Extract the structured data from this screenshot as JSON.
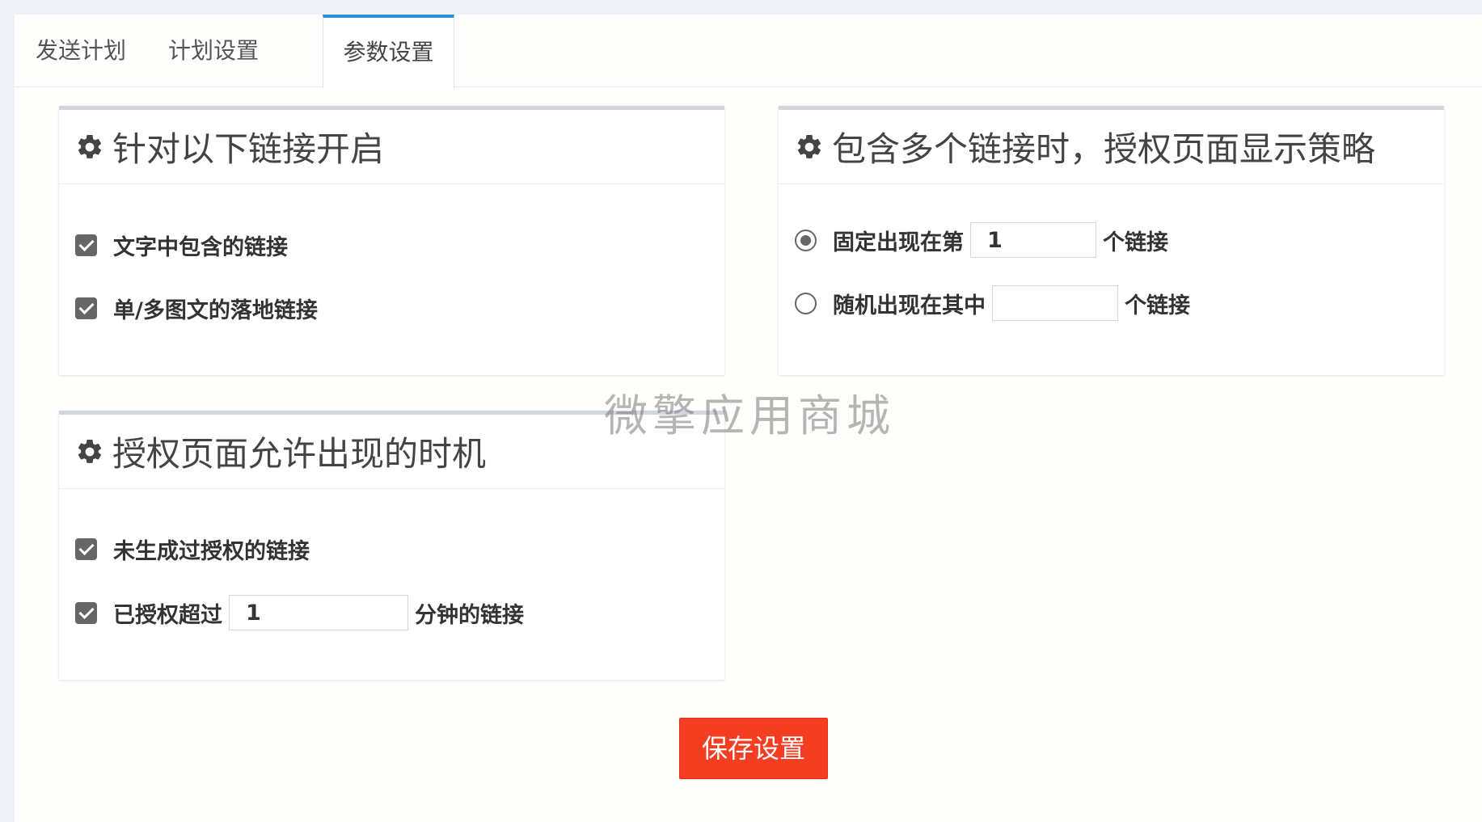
{
  "tabs": [
    {
      "label": "发送计划",
      "active": false
    },
    {
      "label": "计划设置",
      "active": false
    },
    {
      "label": "参数设置",
      "active": true
    }
  ],
  "panel_links": {
    "title": "针对以下链接开启",
    "icon": "gear-icon",
    "options": [
      {
        "label": "文字中包含的链接",
        "checked": true
      },
      {
        "label": "单/多图文的落地链接",
        "checked": true
      }
    ]
  },
  "panel_strategy": {
    "title": "包含多个链接时，授权页面显示策略",
    "icon": "gear-icon",
    "fixed": {
      "label": "固定出现在第",
      "value": "1",
      "suffix": "个链接",
      "selected": true
    },
    "random": {
      "label": "随机出现在其中",
      "value": "",
      "suffix": "个链接",
      "selected": false
    }
  },
  "panel_timing": {
    "title": "授权页面允许出现的时机",
    "icon": "gear-icon",
    "never": {
      "label": "未生成过授权的链接",
      "checked": true
    },
    "exceed": {
      "label": "已授权超过",
      "value": "1",
      "suffix": "分钟的链接",
      "checked": true
    }
  },
  "save_button": "保存设置",
  "watermark": "微擎应用商城",
  "colors": {
    "accent": "#2b8fd6",
    "save": "#f33e22",
    "checkbox": "#666666"
  }
}
